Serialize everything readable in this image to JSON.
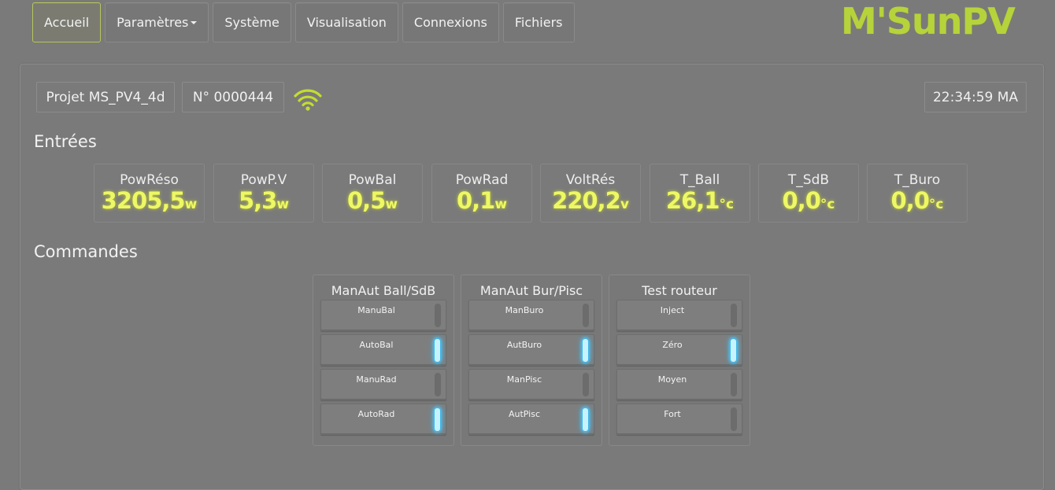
{
  "nav": {
    "items": [
      {
        "label": "Accueil",
        "active": true,
        "dropdown": false
      },
      {
        "label": "Paramètres",
        "active": false,
        "dropdown": true
      },
      {
        "label": "Système",
        "active": false,
        "dropdown": false
      },
      {
        "label": "Visualisation",
        "active": false,
        "dropdown": false
      },
      {
        "label": "Connexions",
        "active": false,
        "dropdown": false
      },
      {
        "label": "Fichiers",
        "active": false,
        "dropdown": false
      }
    ]
  },
  "logo": {
    "text": "M'SunPV",
    "color": "#b6d33b"
  },
  "header": {
    "project": "Projet MS_PV4_4d",
    "serial": "N° 0000444",
    "wifi_icon": "wifi-icon",
    "clock": "22:34:59 MA"
  },
  "inputs": {
    "title": "Entrées",
    "measures": [
      {
        "label": "PowRéso",
        "value": "3205,5",
        "unit": "w"
      },
      {
        "label": "PowP.V",
        "value": "5,3",
        "unit": "w"
      },
      {
        "label": "PowBal",
        "value": "0,5",
        "unit": "w"
      },
      {
        "label": "PowRad",
        "value": "0,1",
        "unit": "w"
      },
      {
        "label": "VoltRés",
        "value": "220,2",
        "unit": "v"
      },
      {
        "label": "T_Ball",
        "value": "26,1",
        "unit": "°c"
      },
      {
        "label": "T_SdB",
        "value": "0,0",
        "unit": "°c"
      },
      {
        "label": "T_Buro",
        "value": "0,0",
        "unit": "°c"
      }
    ]
  },
  "commands": {
    "title": "Commandes",
    "groups": [
      {
        "title": "ManAut Ball/SdB",
        "buttons": [
          {
            "label": "ManuBal",
            "on": false
          },
          {
            "label": "AutoBal",
            "on": true
          },
          {
            "label": "ManuRad",
            "on": false
          },
          {
            "label": "AutoRad",
            "on": true
          }
        ]
      },
      {
        "title": "ManAut Bur/Pisc",
        "buttons": [
          {
            "label": "ManBuro",
            "on": false
          },
          {
            "label": "AutBuro",
            "on": true
          },
          {
            "label": "ManPisc",
            "on": false
          },
          {
            "label": "AutPisc",
            "on": true
          }
        ]
      },
      {
        "title": "Test routeur",
        "buttons": [
          {
            "label": "Inject",
            "on": false
          },
          {
            "label": "Zéro",
            "on": true
          },
          {
            "label": "Moyen",
            "on": false
          },
          {
            "label": "Fort",
            "on": false
          }
        ]
      }
    ]
  },
  "colors": {
    "led_on": "#c7f2ff",
    "value_glow": "#eef866",
    "background": "#7a7a7a"
  }
}
